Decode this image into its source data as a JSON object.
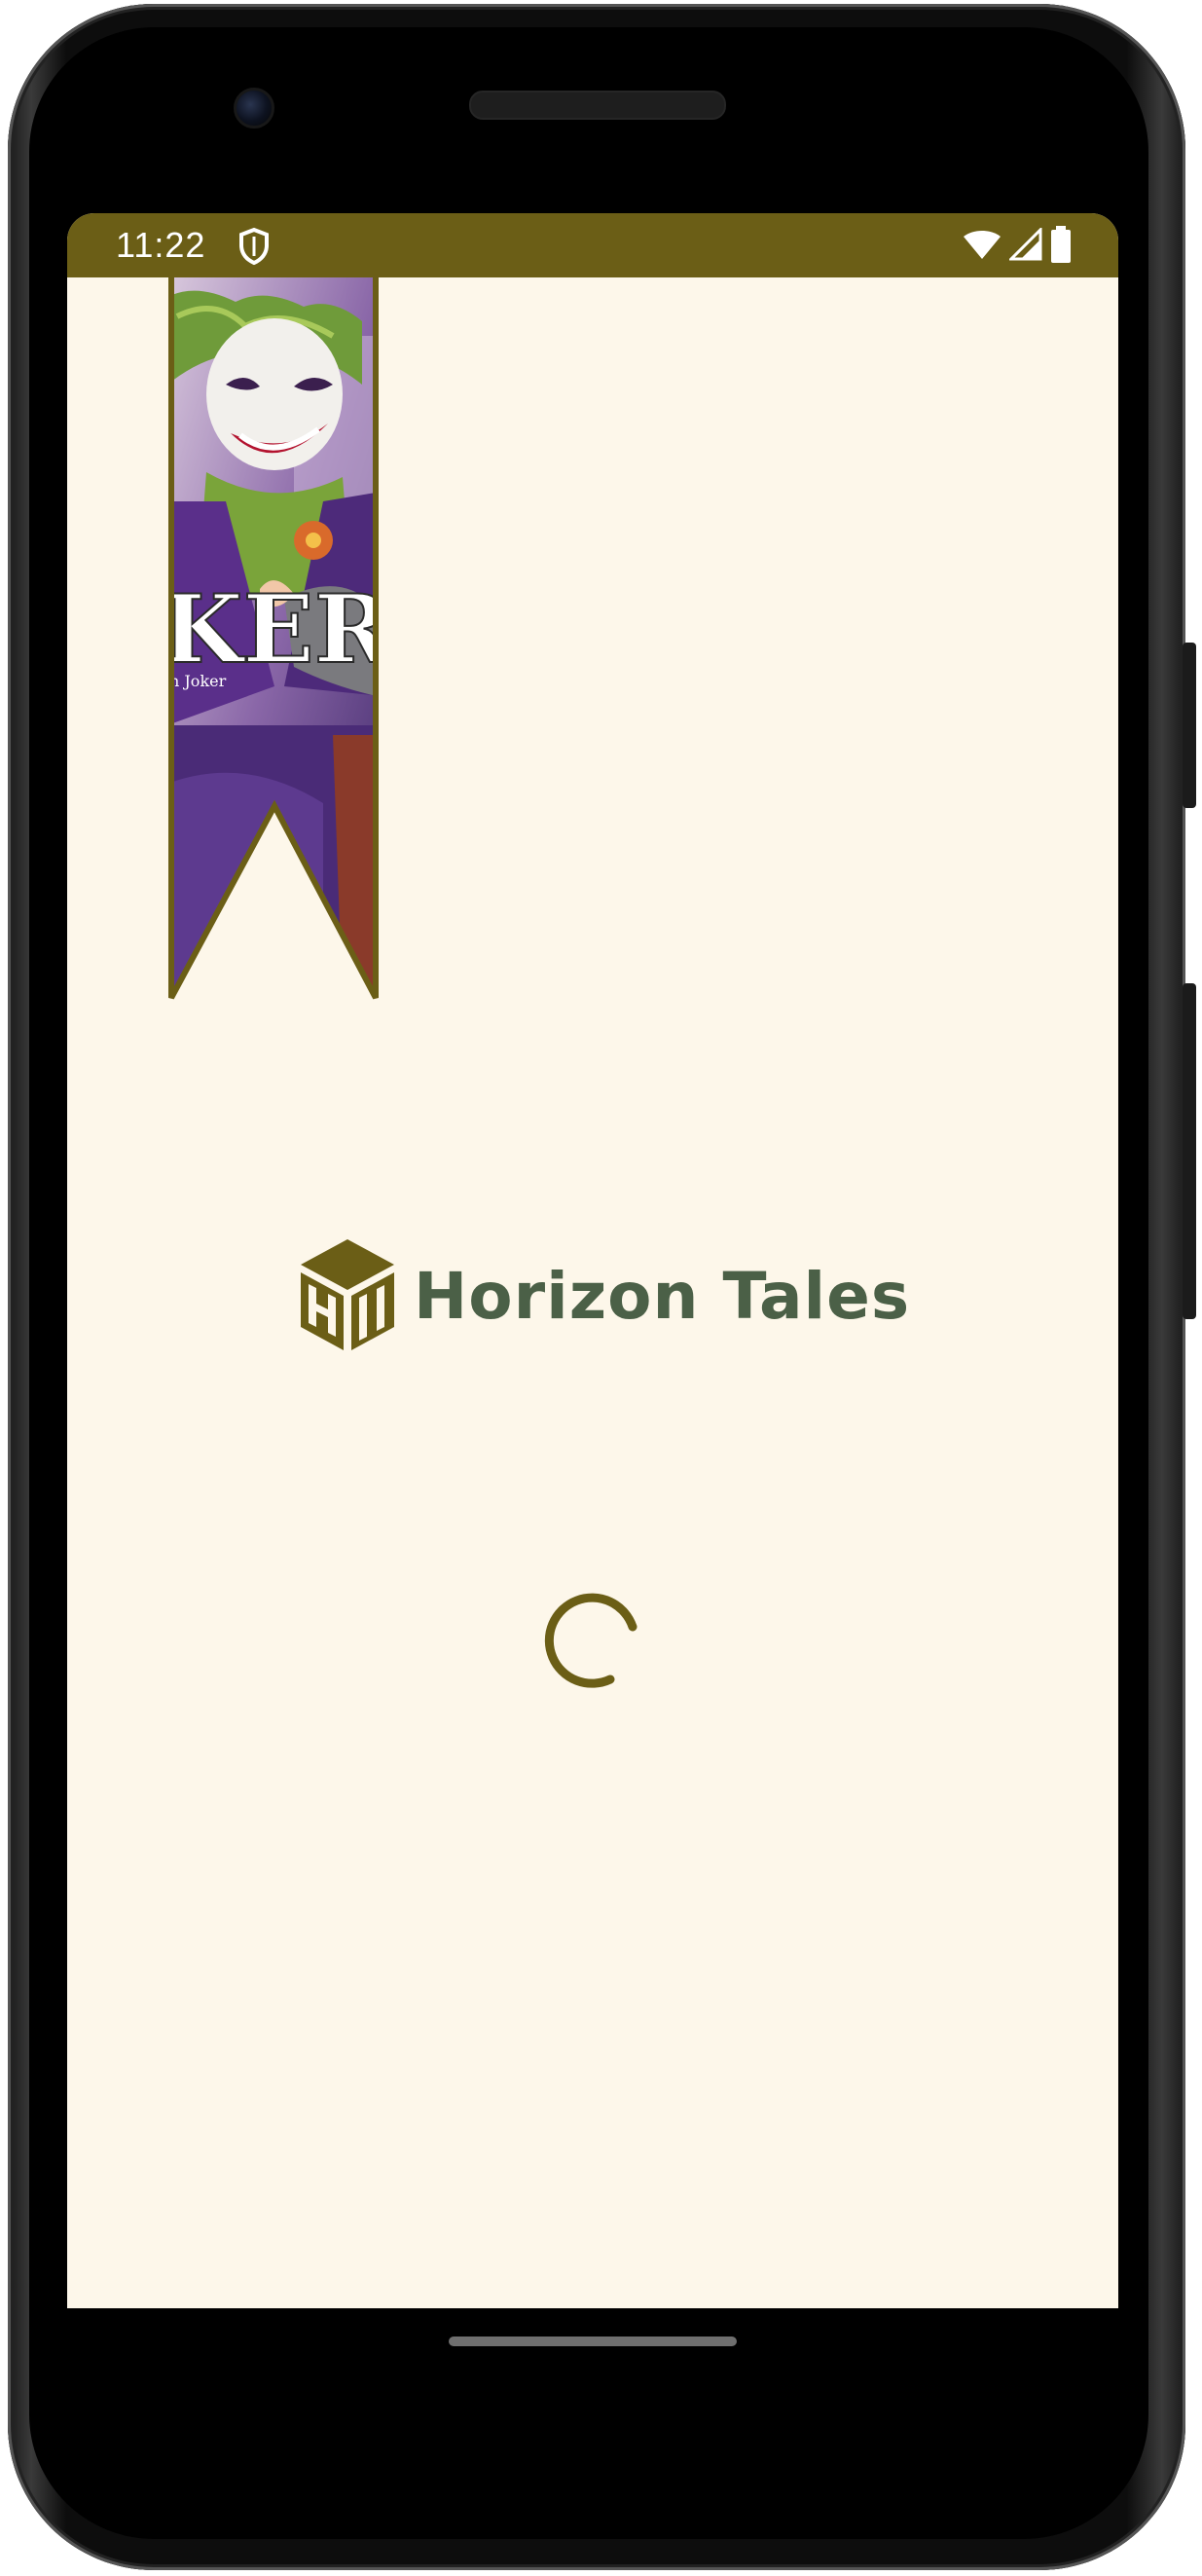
{
  "status_bar": {
    "time": "11:22",
    "shield_icon": "shield-icon",
    "wifi_icon": "wifi-icon",
    "signal_icon": "signal-icon",
    "battery_icon": "battery-icon",
    "background_color": "#6b5e16"
  },
  "splash": {
    "brand_name": "Horizon Tales",
    "brand_text_color": "#4b6047",
    "logo_color": "#6b5e16",
    "background_color": "#fdf7ea",
    "loading_indicator": "spinner-icon"
  },
  "banner": {
    "label": "KER",
    "sublabel": "n  Joker",
    "border_color": "#6b5e16"
  }
}
